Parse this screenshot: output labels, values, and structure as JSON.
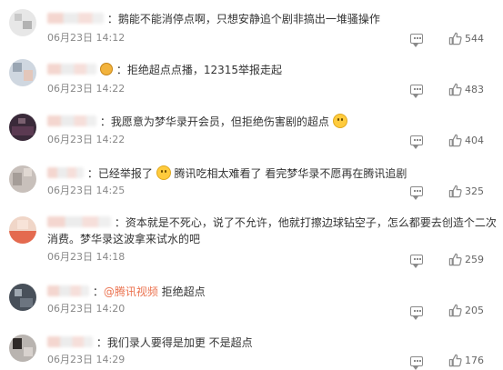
{
  "comments": [
    {
      "text": "鹅能不能消停点啊，只想安静追个剧非搞出一堆骚操作",
      "time": "06月23日 14:12",
      "likes": "544"
    },
    {
      "text": "拒绝超点点播，12315举报走起",
      "time": "06月23日 14:22",
      "likes": "483"
    },
    {
      "text": "我愿意为梦华录开会员，但拒绝伤害剧的超点",
      "time": "06月23日 14:22",
      "likes": "404"
    },
    {
      "text_a": "已经举报了",
      "text_b": "腾讯吃相太难看了 看完梦华录不愿再在腾讯追剧",
      "time": "06月23日 14:25",
      "likes": "325"
    },
    {
      "text": "资本就是不死心，说了不允许，他就打擦边球钻空子，怎么都要去创造个二次消费。梦华录这波拿来试水的吧",
      "time": "06月23日 14:18",
      "likes": "259"
    },
    {
      "mention": "@腾讯视频",
      "text": "拒绝超点",
      "time": "06月23日 14:20",
      "likes": "205"
    },
    {
      "text": "我们录人要得是加更 不是超点",
      "time": "06月23日 14:29",
      "likes": "176"
    }
  ],
  "icons": {
    "reply": "comment-bubble-icon",
    "like": "thumbs-up-icon"
  },
  "colors": {
    "mention": "#eb7350",
    "time": "#888888"
  }
}
